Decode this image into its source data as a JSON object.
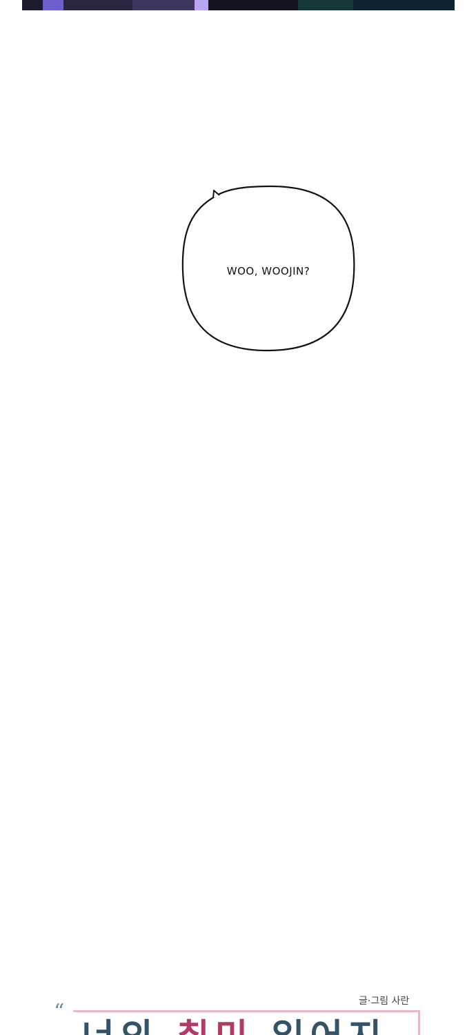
{
  "bubble": {
    "text": "WOO, WOOJIN?"
  },
  "title_card": {
    "credit": "글·그림 사란",
    "title_part1": "너의",
    "title_part2": "취미",
    "title_part3": "일어지"
  },
  "colors": {
    "panel_dark": "#1c1c2e",
    "title_slate": "#355366",
    "title_accent": "#b03a68",
    "frame_pink": "#e8b8c8"
  }
}
